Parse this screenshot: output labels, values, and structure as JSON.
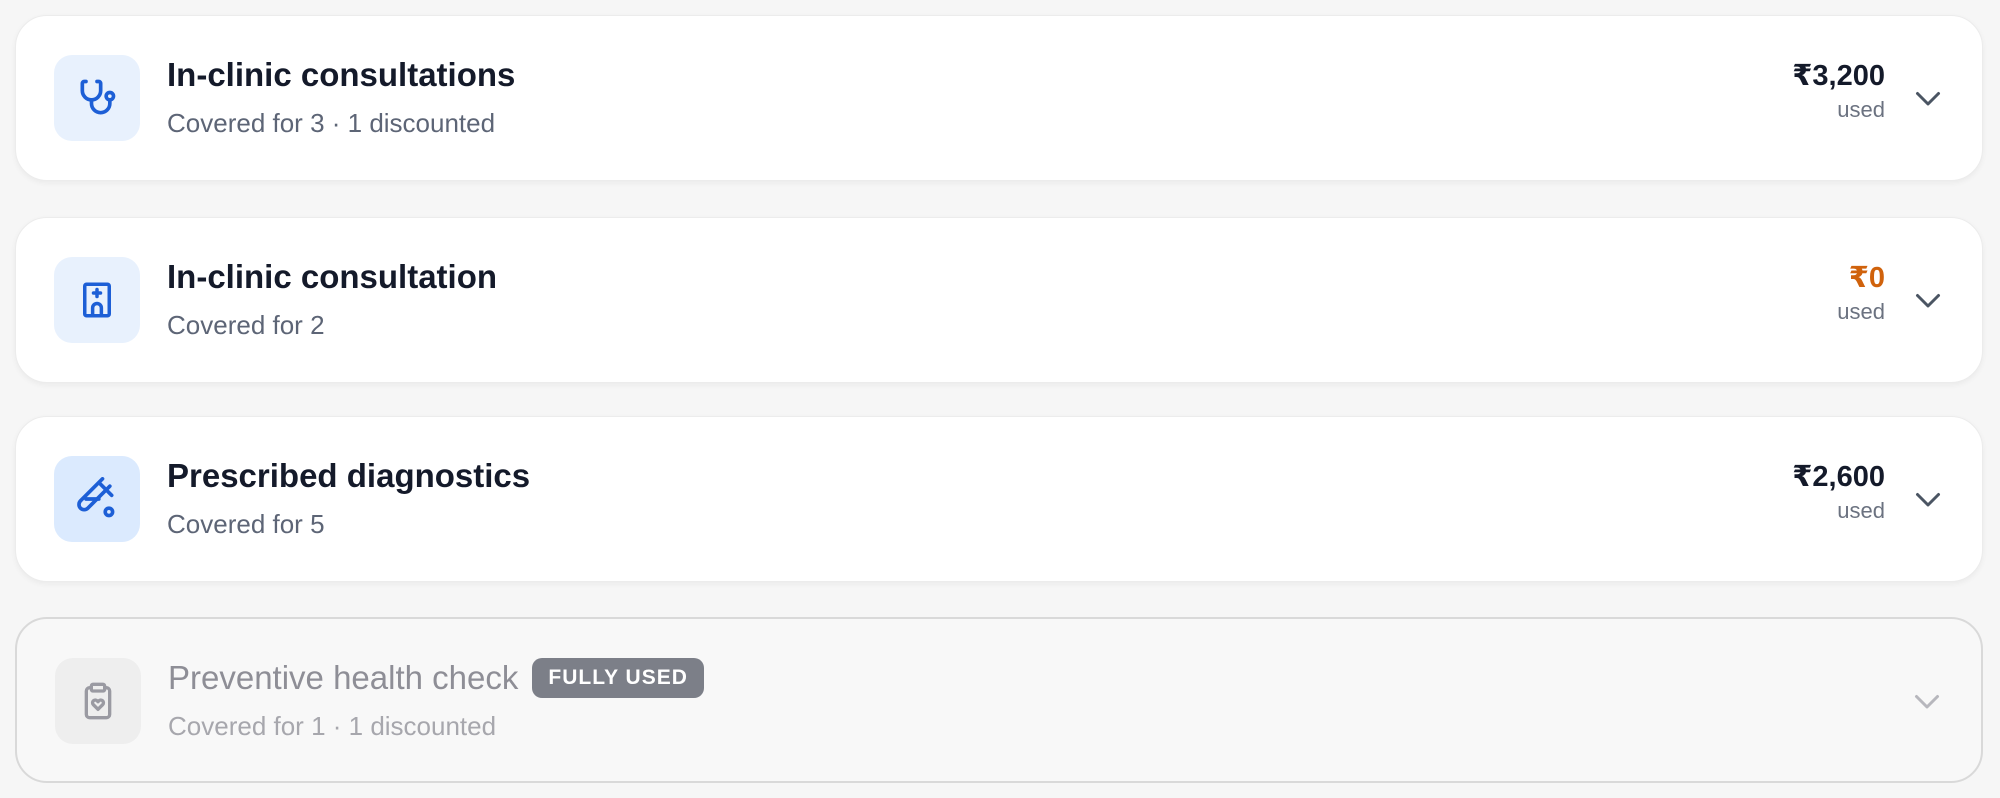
{
  "currency_symbol": "₹",
  "colors": {
    "accent_blue": "#1d5fd6",
    "warning_orange": "#d0620c",
    "badge_gray": "#7c7f88"
  },
  "benefits": [
    {
      "icon": "stethoscope-icon",
      "title": "In-clinic consultations",
      "subtitle": "Covered for 3 · 1 discounted",
      "amount": "₹3,200",
      "used_label": "used"
    },
    {
      "icon": "hospital-icon",
      "title": "In-clinic consultation",
      "subtitle": "Covered for 2",
      "amount": "₹0",
      "used_label": "used"
    },
    {
      "icon": "test-tube-icon",
      "title": "Prescribed diagnostics",
      "subtitle": "Covered for 5",
      "amount": "₹2,600",
      "used_label": "used"
    },
    {
      "icon": "clipboard-heart-icon",
      "title": "Preventive health check",
      "badge": "FULLY USED",
      "subtitle": "Covered for 1 · 1 discounted",
      "status": "fully-used"
    }
  ]
}
